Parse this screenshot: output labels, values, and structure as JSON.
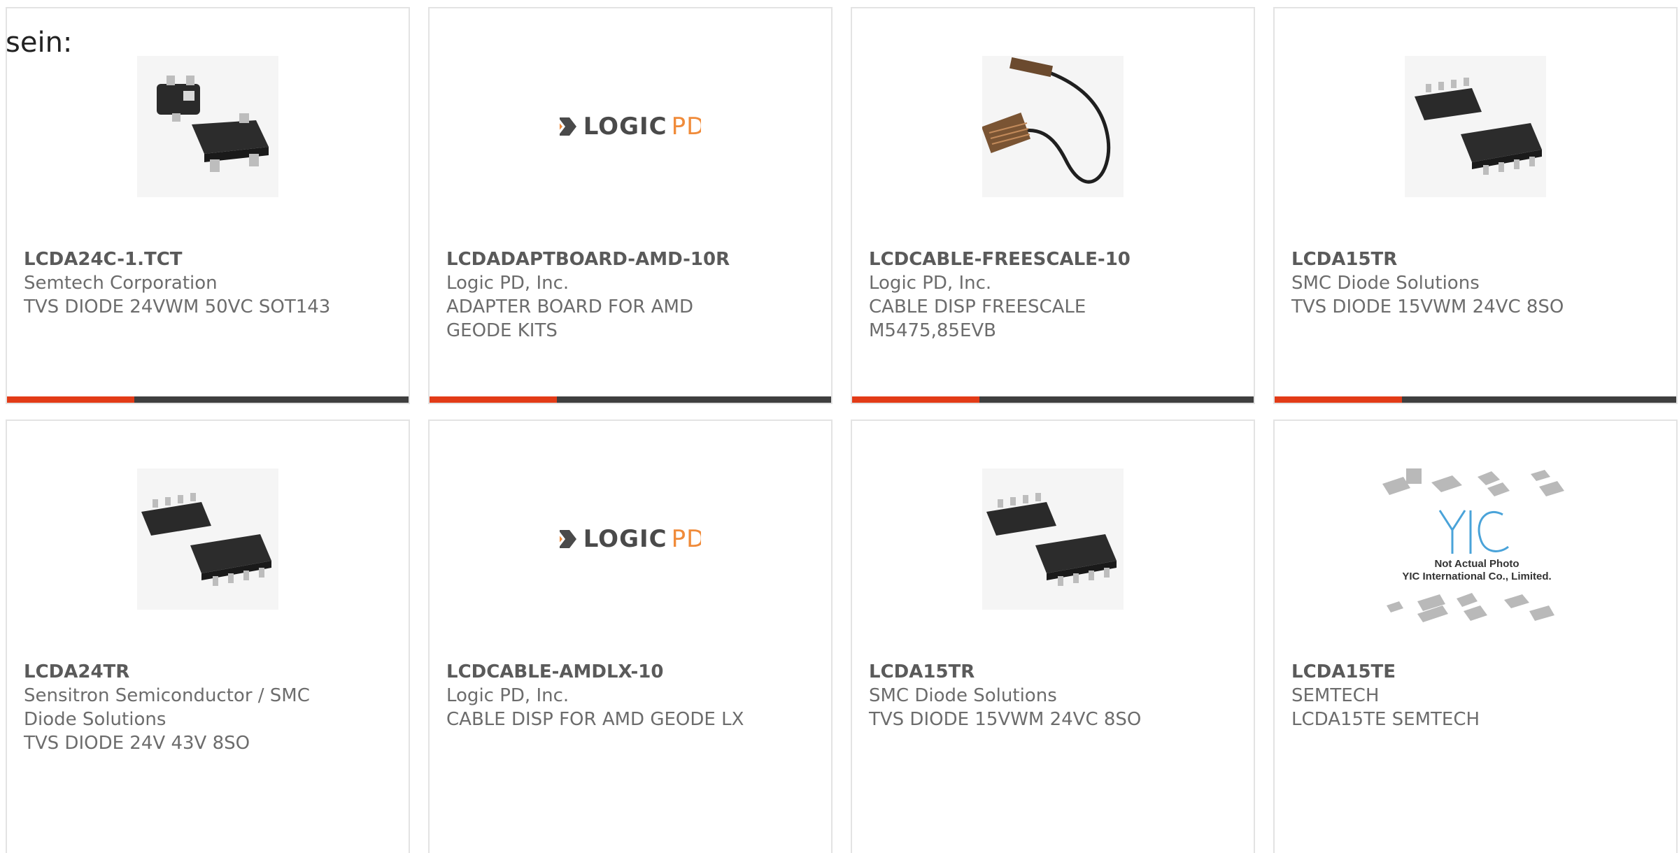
{
  "page": {
    "prefix_text": "sein:"
  },
  "colors": {
    "accent": "#e23b17",
    "bar_dark": "#3f3f3f",
    "card_border": "#e3e3e3",
    "text": "#6c6c6c"
  },
  "products": [
    {
      "part_number": "LCDA24C-1.TCT",
      "manufacturer": "Semtech Corporation",
      "description": "TVS DIODE 24VWM 50VC SOT143",
      "image": "sot143-chip-photo"
    },
    {
      "part_number": "LCDADAPTBOARD-AMD-10R",
      "manufacturer": "Logic PD, Inc.",
      "description": "ADAPTER BOARD FOR AMD GEODE KITS",
      "image": "logicpd-logo",
      "logo_word1": "LOGIC",
      "logo_word2": "PD"
    },
    {
      "part_number": "LCDCABLE-FREESCALE-10",
      "manufacturer": "Logic PD, Inc.",
      "description": "CABLE DISP FREESCALE M5475,85EVB",
      "image": "cable-photo"
    },
    {
      "part_number": "LCDA15TR",
      "manufacturer": "SMC Diode Solutions",
      "description": "TVS DIODE 15VWM 24VC 8SO",
      "image": "soic8-chip-photo"
    },
    {
      "part_number": "LCDA24TR",
      "manufacturer": "Sensitron Semiconductor / SMC Diode Solutions",
      "description": "TVS DIODE 24V 43V 8SO",
      "image": "soic8-chip-photo"
    },
    {
      "part_number": "LCDCABLE-AMDLX-10",
      "manufacturer": "Logic PD, Inc.",
      "description": "CABLE DISP FOR AMD GEODE LX",
      "image": "logicpd-logo",
      "logo_word1": "LOGIC",
      "logo_word2": "PD"
    },
    {
      "part_number": "LCDA15TR",
      "manufacturer": "SMC Diode Solutions",
      "description": "TVS DIODE 15VWM 24VC 8SO",
      "image": "soic8-chip-photo"
    },
    {
      "part_number": "LCDA15TE",
      "manufacturer": "SEMTECH",
      "description": "LCDA15TE SEMTECH",
      "image": "yic-placeholder",
      "placeholder_line1": "Not Actual Photo",
      "placeholder_line2": "YIC International Co., Limited."
    }
  ]
}
